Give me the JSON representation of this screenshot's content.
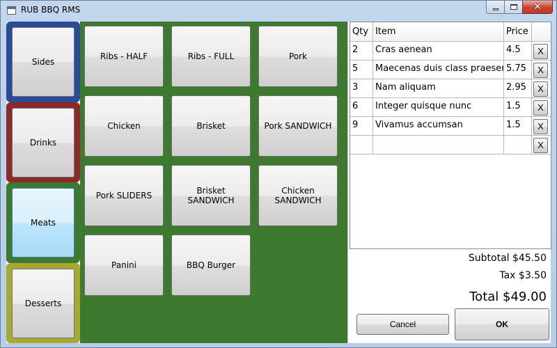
{
  "window": {
    "title": "RUB BBQ RMS"
  },
  "categories": [
    {
      "label": "Sides",
      "color": "#2b4a98"
    },
    {
      "label": "Drinks",
      "color": "#8c2a2a"
    },
    {
      "label": "Meats",
      "color": "#3d7a2f",
      "active": true
    },
    {
      "label": "Desserts",
      "color": "#a8a833"
    }
  ],
  "menu": {
    "background": "#3d7a2f",
    "items": [
      "Ribs - HALF",
      "Ribs - FULL",
      "Pork",
      "Chicken",
      "Brisket",
      "Pork SANDWICH",
      "Pork SLIDERS",
      "Brisket SANDWICH",
      "Chicken SANDWICH",
      "Panini",
      "BBQ Burger"
    ]
  },
  "order": {
    "headers": {
      "qty": "Qty",
      "item": "Item",
      "price": "Price"
    },
    "rows": [
      {
        "qty": "2",
        "item": "Cras aenean",
        "price": "4.5"
      },
      {
        "qty": "5",
        "item": "Maecenas duis class praesent",
        "price": "5.75"
      },
      {
        "qty": "3",
        "item": "Nam aliquam",
        "price": "2.95"
      },
      {
        "qty": "6",
        "item": "Integer quisque nunc",
        "price": "1.5"
      },
      {
        "qty": "9",
        "item": "Vivamus accumsan",
        "price": "1.5"
      },
      {
        "qty": "",
        "item": "",
        "price": ""
      }
    ],
    "remove_label": "X",
    "subtotal": "Subtotal $45.50",
    "tax": "Tax $3.50",
    "total": "Total $49.00",
    "cancel_label": "Cancel",
    "ok_label": "OK"
  }
}
